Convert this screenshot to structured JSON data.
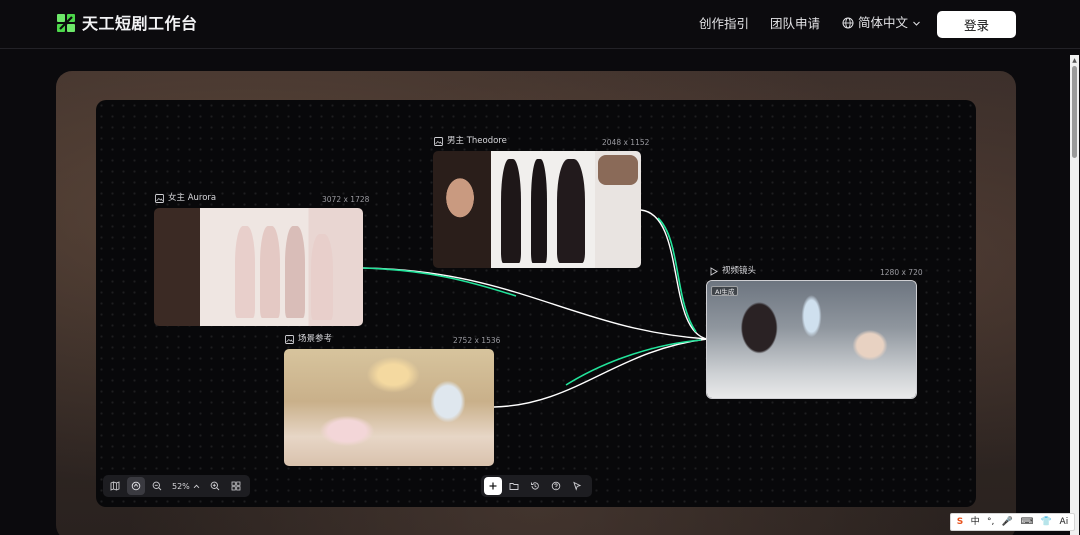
{
  "header": {
    "brand": "天工短剧工作台",
    "nav": [
      "创作指引",
      "团队申请"
    ],
    "language": "简体中文",
    "login_label": "登录"
  },
  "canvas": {
    "nodes": {
      "heroine": {
        "title": "女主 Aurora",
        "size": "3072 x 1728"
      },
      "hero": {
        "title": "男主 Theodore",
        "size": "2048 x 1152"
      },
      "scene": {
        "title": "场景参考",
        "size": "2752 x 1536"
      },
      "shot": {
        "title": "视频镜头",
        "size": "1280 x 720",
        "badge": "AI生成"
      }
    },
    "connector_color": "#22e39a",
    "zoom": "52%"
  },
  "ime": {
    "items": [
      "S",
      "中",
      "°,",
      "🎤",
      "⌨",
      "👕",
      "Ai"
    ]
  },
  "colors": {
    "accent": "#22e39a",
    "brand": "#5be85b",
    "background": "#0b0a0d"
  }
}
